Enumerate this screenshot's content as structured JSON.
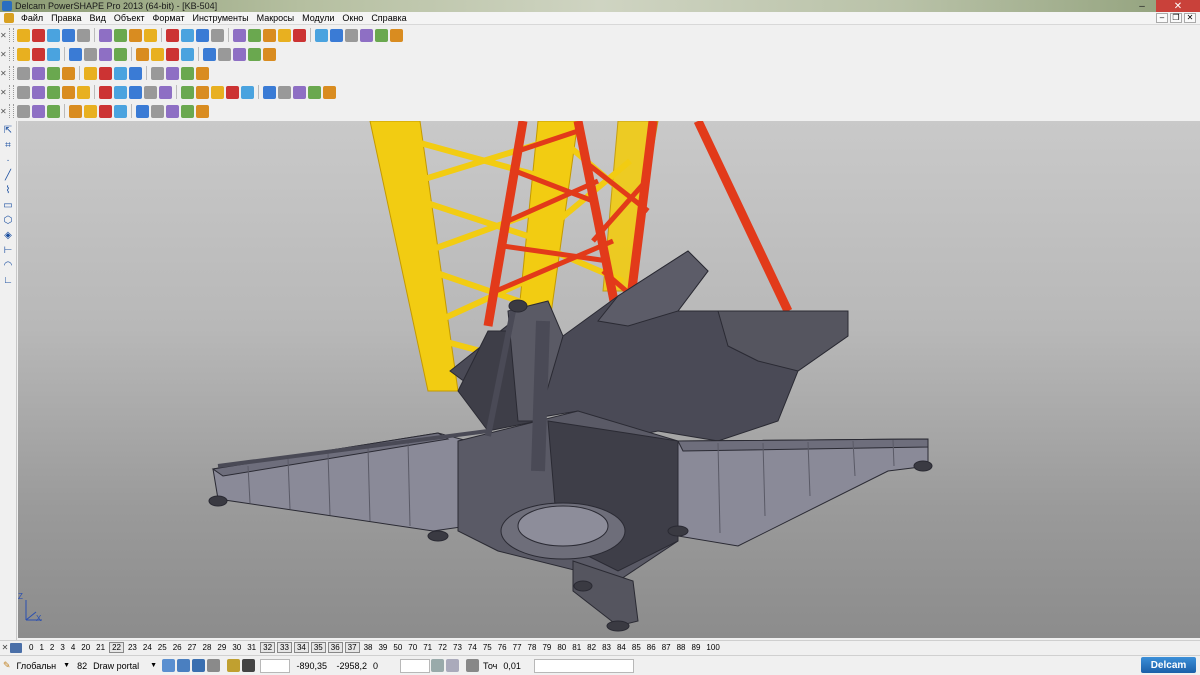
{
  "window": {
    "title": "Delcam PowerSHAPE Pro 2013 (64-bit) - [KB-504]",
    "minimize": "–",
    "close": "✕"
  },
  "menu": {
    "items": [
      "Файл",
      "Правка",
      "Вид",
      "Объект",
      "Формат",
      "Инструменты",
      "Макросы",
      "Модули",
      "Окно",
      "Справка"
    ]
  },
  "layers": {
    "items": [
      "0",
      "1",
      "2",
      "3",
      "4",
      "20",
      "21",
      "22",
      "23",
      "24",
      "25",
      "26",
      "27",
      "28",
      "29",
      "30",
      "31",
      "32",
      "33",
      "34",
      "35",
      "36",
      "37",
      "38",
      "39",
      "50",
      "70",
      "71",
      "72",
      "73",
      "74",
      "75",
      "76",
      "77",
      "78",
      "79",
      "80",
      "81",
      "82",
      "83",
      "84",
      "85",
      "86",
      "87",
      "88",
      "89",
      "100"
    ],
    "boxed": [
      "22",
      "32",
      "33",
      "34",
      "35",
      "36",
      "37"
    ]
  },
  "status": {
    "workplane": "Глобальн",
    "level_number": "82",
    "level_name": "Draw portal",
    "x": "-890,35",
    "y": "-2958,2",
    "z": "0",
    "tolerance_label": "Точ",
    "tolerance": "0,01",
    "brand": "Delcam"
  },
  "axis": {
    "x_label": "X",
    "z_label": "Z"
  },
  "colors": {
    "viewport_top": "#c9c9c9",
    "viewport_bottom": "#8c8c8c",
    "yellow_lattice": "#f2cc12",
    "red_lattice": "#e23a1a",
    "frame_grey": "#4a4a56"
  },
  "icons": {
    "toolbar_colors": [
      "#e8b020",
      "#3a7bd5",
      "#6aa84f",
      "#cc3333",
      "#999999",
      "#d98c20",
      "#4aa3df",
      "#8e6fc4"
    ]
  }
}
